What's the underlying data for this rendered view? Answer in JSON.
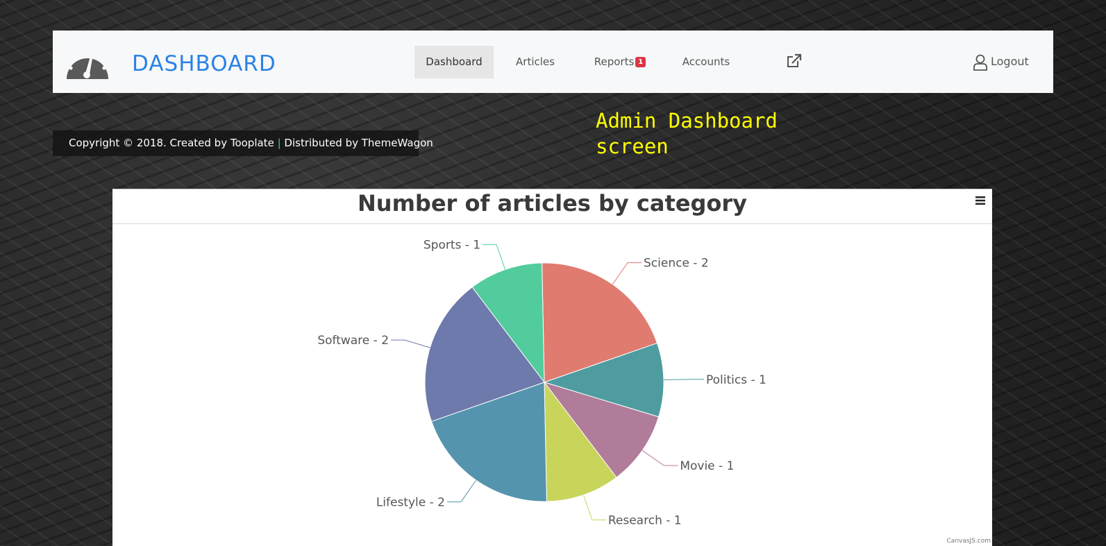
{
  "navbar": {
    "brand": "DASHBOARD",
    "items": [
      {
        "label": "Dashboard",
        "active": true
      },
      {
        "label": "Articles",
        "active": false
      },
      {
        "label": "Reports",
        "active": false,
        "badge": "1"
      },
      {
        "label": "Accounts",
        "active": false
      }
    ],
    "external_icon": "external-link-icon",
    "logout_label": "Logout"
  },
  "footer": {
    "copyright": "Copyright © 2018. Created by Tooplate",
    "separator": "|",
    "distributed": "Distributed by ThemeWagon"
  },
  "caption": "Admin Dashboard screen",
  "colors": {
    "brand": "#2a82e4",
    "caption": "#ffff00",
    "badge": "#dc3545"
  },
  "chart_data": {
    "type": "pie",
    "title": "Number of articles by category",
    "credit": "CanvasJS.com",
    "slices": [
      {
        "label": "Science",
        "value": 2,
        "color": "#e07b6f"
      },
      {
        "label": "Politics",
        "value": 1,
        "color": "#4e9ca0"
      },
      {
        "label": "Movie",
        "value": 1,
        "color": "#b07c99"
      },
      {
        "label": "Research",
        "value": 1,
        "color": "#c9d45b"
      },
      {
        "label": "Lifestyle",
        "value": 2,
        "color": "#5594ae"
      },
      {
        "label": "Software",
        "value": 2,
        "color": "#6e7aab"
      },
      {
        "label": "Sports",
        "value": 1,
        "color": "#52cc9c"
      }
    ]
  }
}
